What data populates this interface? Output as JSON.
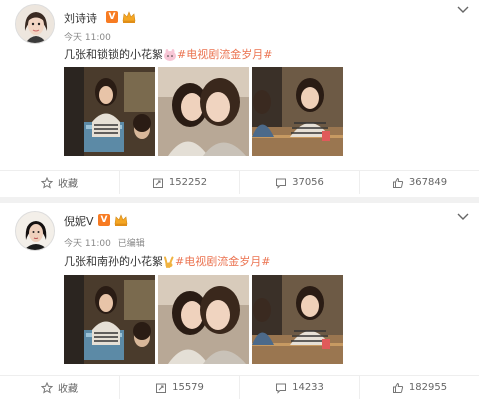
{
  "posts": [
    {
      "username": "刘诗诗",
      "badge": "V",
      "meta": "今天 11:00",
      "text_main": "几张和锁锁的小花絮",
      "hashtag": "#电视剧流金岁月#",
      "actions": {
        "favorite": "收藏",
        "repost": "152252",
        "comment": "37056",
        "like": "367849"
      }
    },
    {
      "username": "倪妮V",
      "badge": "V",
      "meta_time": "今天 11:00",
      "meta_edited": "已编辑",
      "text_main": "几张和南孙的小花絮",
      "hashtag": "#电视剧流金岁月#",
      "actions": {
        "favorite": "收藏",
        "repost": "15579",
        "comment": "14233",
        "like": "182955"
      }
    }
  ],
  "colors": {
    "accent": "#eb7350",
    "badge": "#f77b22",
    "muted": "#888888"
  }
}
